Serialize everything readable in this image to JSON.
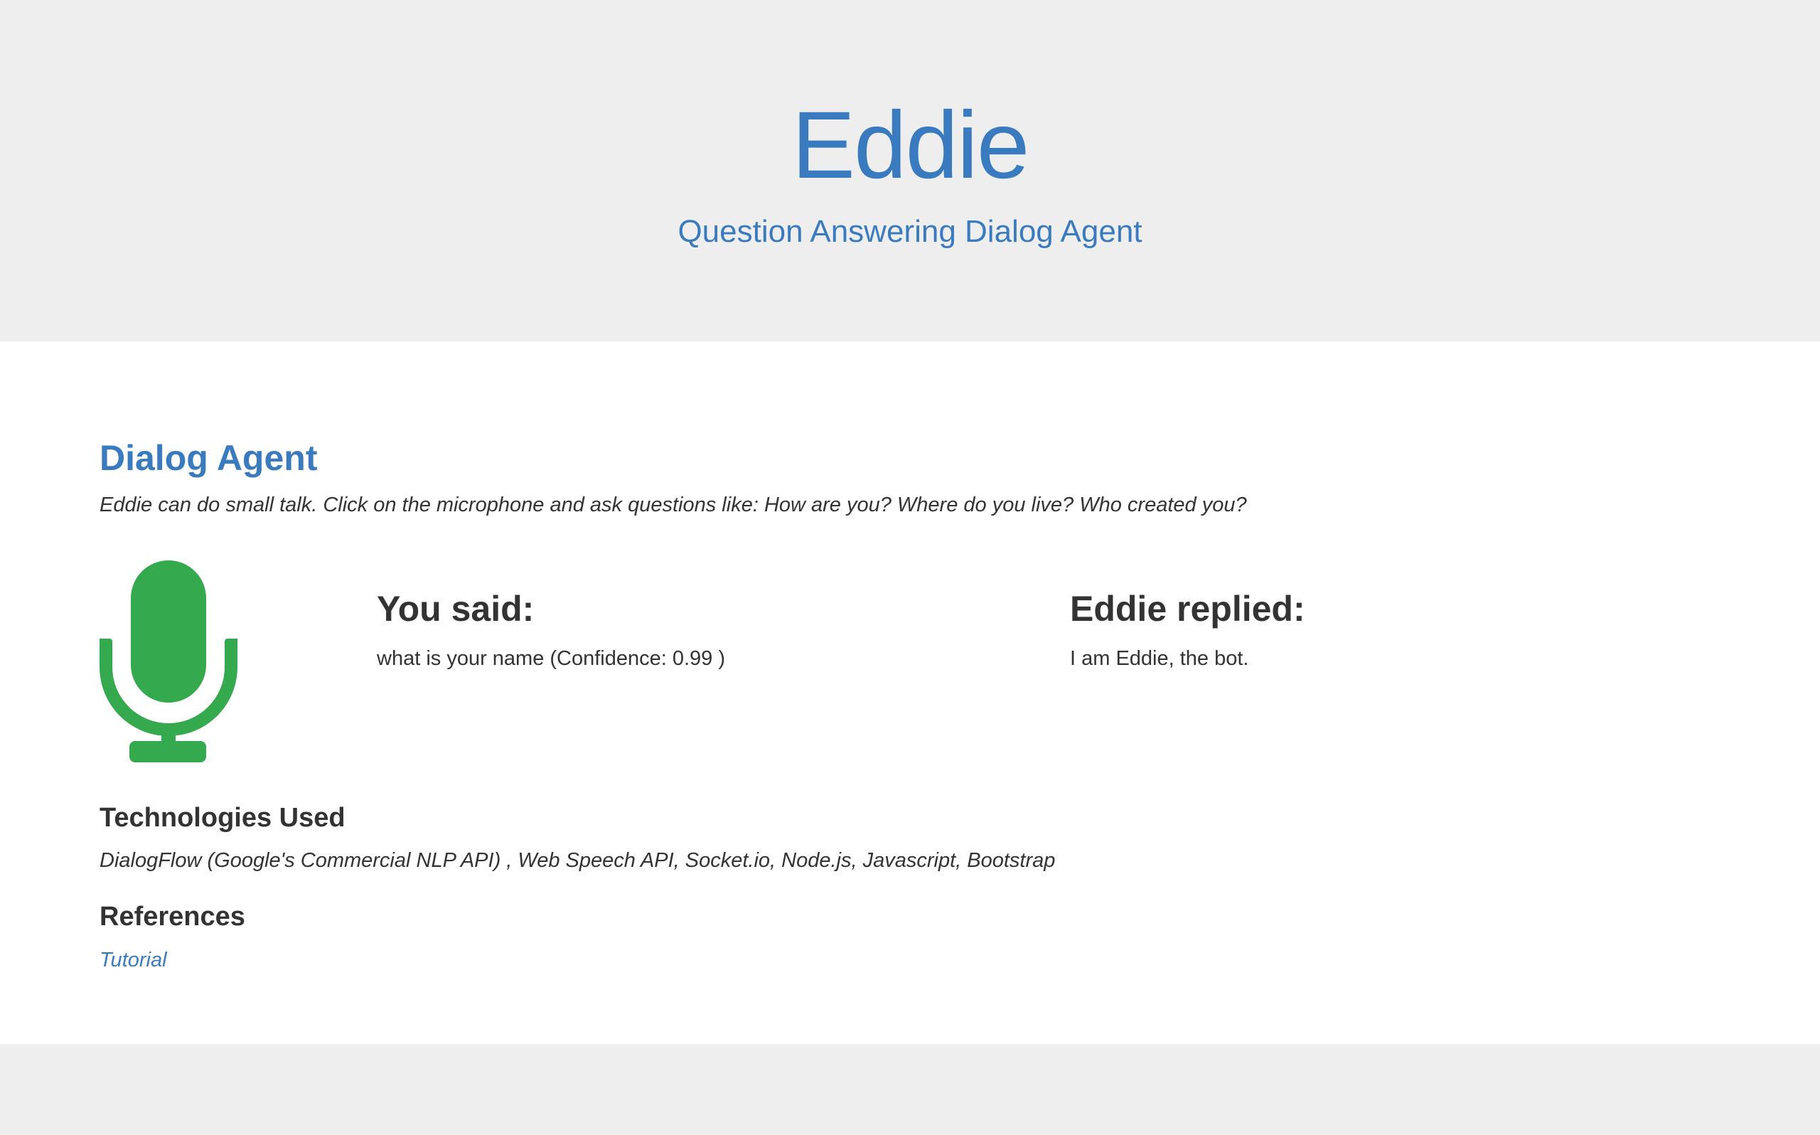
{
  "header": {
    "title": "Eddie",
    "subtitle": "Question Answering Dialog Agent"
  },
  "dialog": {
    "section_title": "Dialog Agent",
    "intro": "Eddie can do small talk. Click on the microphone and ask questions like: How are you? Where do you live? Who created you?",
    "mic_icon": "microphone-icon",
    "mic_color": "#34a94d",
    "you_said_label": "You said:",
    "you_said_text": "what is your name (Confidence: 0.99 )",
    "reply_label": "Eddie replied:",
    "reply_text": "I am Eddie, the bot."
  },
  "technologies": {
    "title": "Technologies Used",
    "text": "DialogFlow (Google's Commercial NLP API) , Web Speech API, Socket.io, Node.js, Javascript, Bootstrap"
  },
  "references": {
    "title": "References",
    "link_label": "Tutorial"
  },
  "colors": {
    "accent": "#3a7bbf",
    "jumbotron_bg": "#eeeeee",
    "text": "#333333"
  }
}
